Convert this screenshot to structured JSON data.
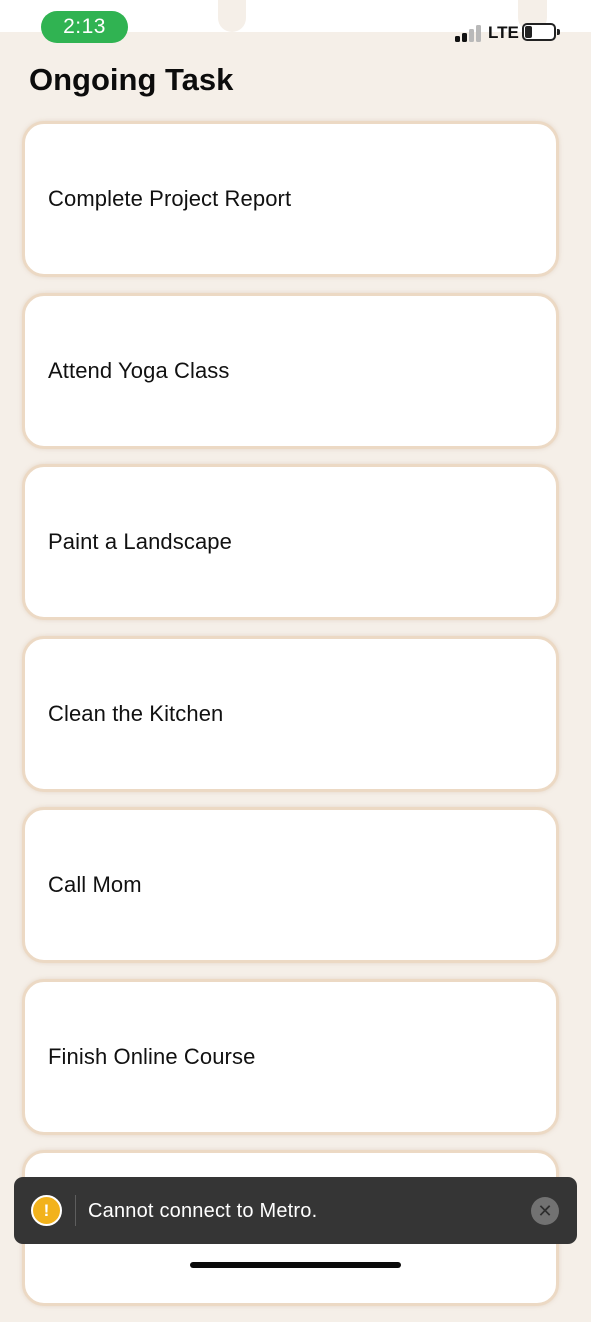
{
  "status_bar": {
    "time": "2:13",
    "network": "LTE",
    "battery_level": "31",
    "battery_fraction": 0.31,
    "signal_bars_filled": 2,
    "signal_bars_total": 4
  },
  "header": {
    "title": "Ongoing Task"
  },
  "tasks": [
    {
      "label": "Complete Project Report"
    },
    {
      "label": "Attend Yoga Class"
    },
    {
      "label": "Paint a Landscape"
    },
    {
      "label": "Clean the Kitchen"
    },
    {
      "label": "Call Mom"
    },
    {
      "label": "Finish Online Course"
    },
    {
      "label": ""
    }
  ],
  "toast": {
    "icon": "warning-icon",
    "icon_glyph": "!",
    "message": "Cannot connect to Metro.",
    "close_glyph": "✕"
  },
  "colors": {
    "background": "#f5efe8",
    "card_border": "#ecd9c4",
    "time_pill": "#30b352",
    "toast_background": "#353535",
    "warning": "#f2b21c"
  }
}
